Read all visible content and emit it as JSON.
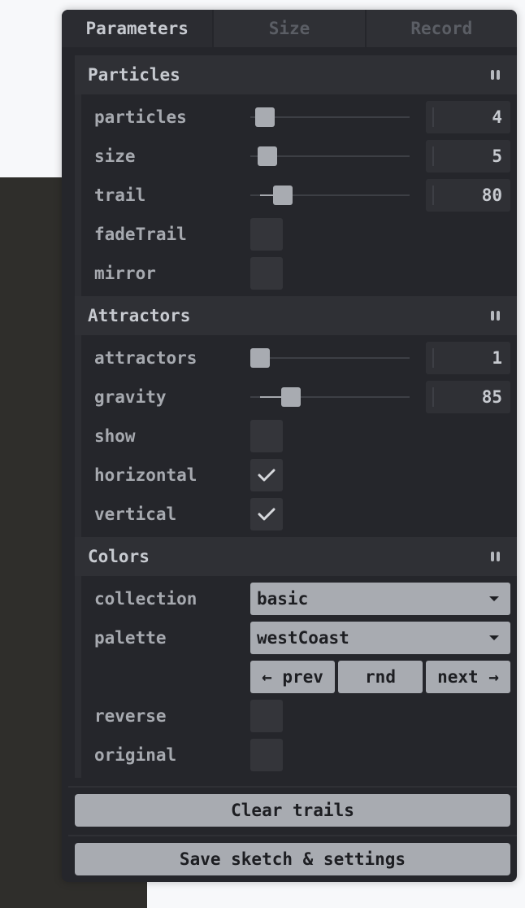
{
  "tabs": [
    {
      "label": "Parameters",
      "active": true
    },
    {
      "label": "Size",
      "active": false
    },
    {
      "label": "Record",
      "active": false
    }
  ],
  "particles": {
    "title": "Particles",
    "rows": {
      "particles": {
        "label": "particles",
        "value": "4"
      },
      "size": {
        "label": "size",
        "value": "5"
      },
      "trail": {
        "label": "trail",
        "value": "80"
      },
      "fadeTrail": {
        "label": "fadeTrail",
        "checked": false
      },
      "mirror": {
        "label": "mirror",
        "checked": false
      }
    }
  },
  "attractors": {
    "title": "Attractors",
    "rows": {
      "attractors": {
        "label": "attractors",
        "value": "1"
      },
      "gravity": {
        "label": "gravity",
        "value": "85"
      },
      "show": {
        "label": "show",
        "checked": false
      },
      "horizontal": {
        "label": "horizontal",
        "checked": true
      },
      "vertical": {
        "label": "vertical",
        "checked": true
      }
    }
  },
  "colors": {
    "title": "Colors",
    "rows": {
      "collection": {
        "label": "collection",
        "value": "basic"
      },
      "palette": {
        "label": "palette",
        "value": "westCoast"
      },
      "buttons": {
        "prev": "← prev",
        "rnd": "rnd",
        "next": "next →"
      },
      "reverse": {
        "label": "reverse",
        "checked": false
      },
      "original": {
        "label": "original",
        "checked": false
      }
    }
  },
  "actions": {
    "clear": "Clear trails",
    "save": "Save sketch & settings"
  },
  "colors_theme": {
    "panel_bg": "#25262b",
    "header_bg": "#2f3035",
    "widget_light": "#a8abb1",
    "text_light": "#c7cad0",
    "text_label": "#a6a9af",
    "canvas": "#2f2e2b"
  },
  "icons": [
    "collapse-icon",
    "check-icon",
    "caret-down-icon"
  ]
}
